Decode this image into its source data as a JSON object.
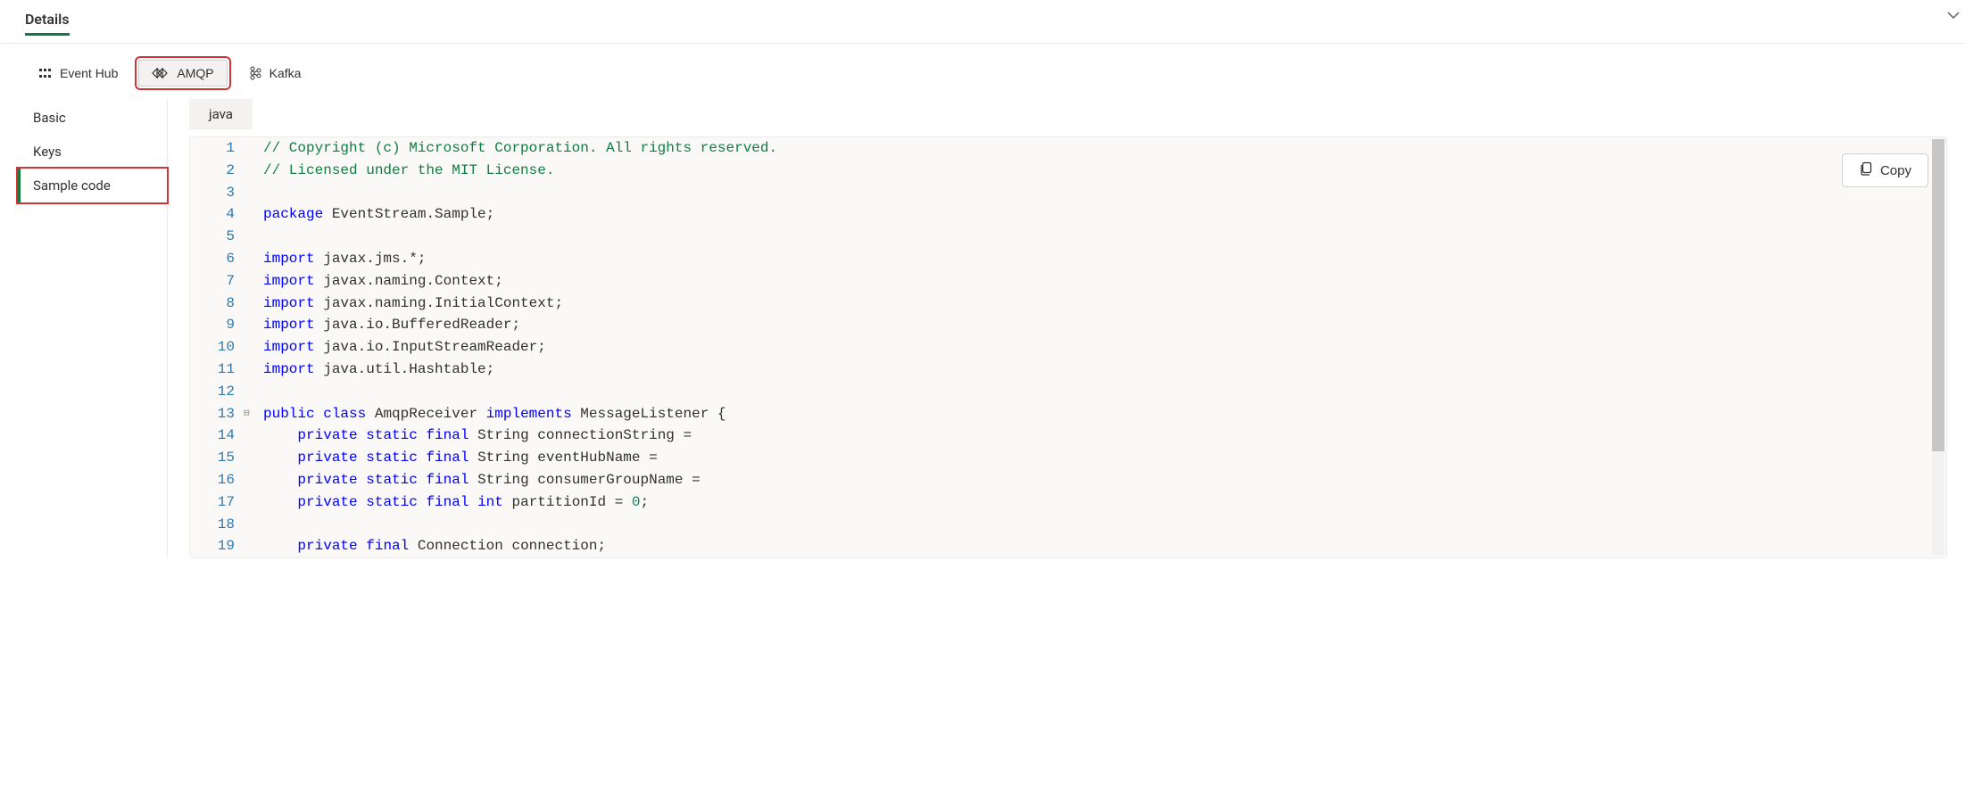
{
  "header": {
    "title": "Details"
  },
  "protocolTabs": [
    {
      "label": "Event Hub",
      "selected": false,
      "highlighted": false,
      "iconName": "eventhub-icon"
    },
    {
      "label": "AMQP",
      "selected": true,
      "highlighted": true,
      "iconName": "amqp-icon"
    },
    {
      "label": "Kafka",
      "selected": false,
      "highlighted": false,
      "iconName": "kafka-icon"
    }
  ],
  "sideNav": {
    "items": [
      {
        "label": "Basic",
        "selected": false,
        "highlighted": false
      },
      {
        "label": "Keys",
        "selected": false,
        "highlighted": false
      },
      {
        "label": "Sample code",
        "selected": true,
        "highlighted": true
      }
    ]
  },
  "languageChip": "java",
  "copy": {
    "label": "Copy"
  },
  "code": {
    "lines": [
      {
        "n": 1,
        "tokens": [
          {
            "t": "// Copyright (c) Microsoft Corporation. All rights reserved.",
            "c": "tok-comment"
          }
        ]
      },
      {
        "n": 2,
        "tokens": [
          {
            "t": "// Licensed under the MIT License.",
            "c": "tok-comment"
          }
        ]
      },
      {
        "n": 3,
        "tokens": []
      },
      {
        "n": 4,
        "tokens": [
          {
            "t": "package",
            "c": "tok-keyword"
          },
          {
            "t": " EventStream.Sample;",
            "c": ""
          }
        ]
      },
      {
        "n": 5,
        "tokens": []
      },
      {
        "n": 6,
        "tokens": [
          {
            "t": "import",
            "c": "tok-keyword"
          },
          {
            "t": " javax.jms.*;",
            "c": ""
          }
        ]
      },
      {
        "n": 7,
        "tokens": [
          {
            "t": "import",
            "c": "tok-keyword"
          },
          {
            "t": " javax.naming.Context;",
            "c": ""
          }
        ]
      },
      {
        "n": 8,
        "tokens": [
          {
            "t": "import",
            "c": "tok-keyword"
          },
          {
            "t": " javax.naming.InitialContext;",
            "c": ""
          }
        ]
      },
      {
        "n": 9,
        "tokens": [
          {
            "t": "import",
            "c": "tok-keyword"
          },
          {
            "t": " java.io.BufferedReader;",
            "c": ""
          }
        ]
      },
      {
        "n": 10,
        "tokens": [
          {
            "t": "import",
            "c": "tok-keyword"
          },
          {
            "t": " java.io.InputStreamReader;",
            "c": ""
          }
        ]
      },
      {
        "n": 11,
        "tokens": [
          {
            "t": "import",
            "c": "tok-keyword"
          },
          {
            "t": " java.util.Hashtable;",
            "c": ""
          }
        ]
      },
      {
        "n": 12,
        "tokens": []
      },
      {
        "n": 13,
        "fold": "⊟",
        "tokens": [
          {
            "t": "public",
            "c": "tok-keyword"
          },
          {
            "t": " ",
            "c": ""
          },
          {
            "t": "class",
            "c": "tok-keyword"
          },
          {
            "t": " AmqpReceiver ",
            "c": ""
          },
          {
            "t": "implements",
            "c": "tok-keyword"
          },
          {
            "t": " MessageListener {",
            "c": ""
          }
        ]
      },
      {
        "n": 14,
        "indent": 1,
        "tokens": [
          {
            "t": "private",
            "c": "tok-keyword"
          },
          {
            "t": " ",
            "c": ""
          },
          {
            "t": "static",
            "c": "tok-keyword"
          },
          {
            "t": " ",
            "c": ""
          },
          {
            "t": "final",
            "c": "tok-keyword"
          },
          {
            "t": " String connectionString =",
            "c": ""
          }
        ]
      },
      {
        "n": 15,
        "indent": 1,
        "tokens": [
          {
            "t": "private",
            "c": "tok-keyword"
          },
          {
            "t": " ",
            "c": ""
          },
          {
            "t": "static",
            "c": "tok-keyword"
          },
          {
            "t": " ",
            "c": ""
          },
          {
            "t": "final",
            "c": "tok-keyword"
          },
          {
            "t": " String eventHubName =",
            "c": ""
          }
        ]
      },
      {
        "n": 16,
        "indent": 1,
        "tokens": [
          {
            "t": "private",
            "c": "tok-keyword"
          },
          {
            "t": " ",
            "c": ""
          },
          {
            "t": "static",
            "c": "tok-keyword"
          },
          {
            "t": " ",
            "c": ""
          },
          {
            "t": "final",
            "c": "tok-keyword"
          },
          {
            "t": " String consumerGroupName =",
            "c": ""
          }
        ]
      },
      {
        "n": 17,
        "indent": 1,
        "tokens": [
          {
            "t": "private",
            "c": "tok-keyword"
          },
          {
            "t": " ",
            "c": ""
          },
          {
            "t": "static",
            "c": "tok-keyword"
          },
          {
            "t": " ",
            "c": ""
          },
          {
            "t": "final",
            "c": "tok-keyword"
          },
          {
            "t": " ",
            "c": ""
          },
          {
            "t": "int",
            "c": "tok-keyword"
          },
          {
            "t": " partitionId = ",
            "c": ""
          },
          {
            "t": "0",
            "c": "tok-num"
          },
          {
            "t": ";",
            "c": ""
          }
        ]
      },
      {
        "n": 18,
        "indent": 1,
        "tokens": []
      },
      {
        "n": 19,
        "indent": 1,
        "tokens": [
          {
            "t": "private",
            "c": "tok-keyword"
          },
          {
            "t": " ",
            "c": ""
          },
          {
            "t": "final",
            "c": "tok-keyword"
          },
          {
            "t": " Connection connection;",
            "c": ""
          }
        ]
      }
    ]
  }
}
